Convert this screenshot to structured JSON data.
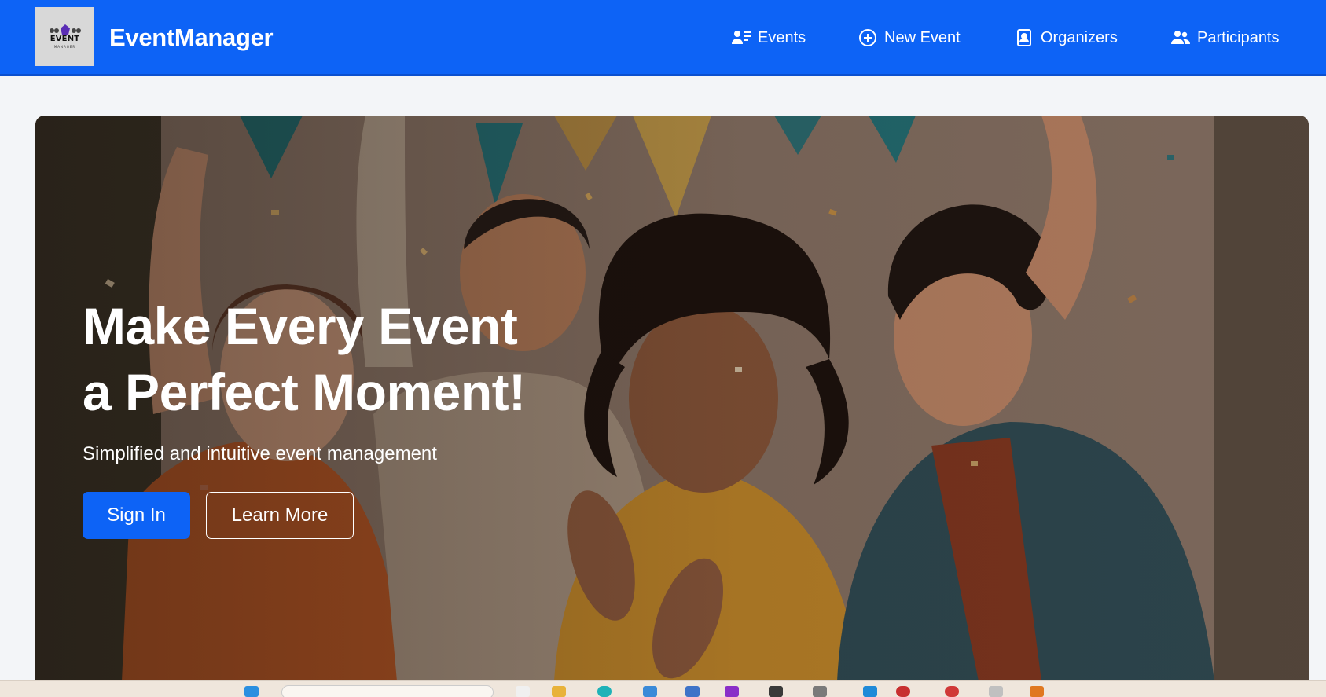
{
  "brand": {
    "logo_text": "EVENT",
    "logo_sub": "MANAGER",
    "name": "EventManager"
  },
  "nav": {
    "events": "Events",
    "new_event": "New Event",
    "organizers": "Organizers",
    "participants": "Participants"
  },
  "hero": {
    "title_line1": "Make Every Event",
    "title_line2": "a Perfect Moment!",
    "subtitle": "Simplified and intuitive event management",
    "primary_button": "Sign In",
    "secondary_button": "Learn More"
  },
  "colors": {
    "primary": "#0d63f6",
    "nav_text": "#ffffff",
    "page_bg": "#f3f5f8"
  },
  "icons": {
    "events": "people-list-icon",
    "new_event": "plus-circle-icon",
    "organizers": "id-badge-icon",
    "participants": "people-icon"
  }
}
